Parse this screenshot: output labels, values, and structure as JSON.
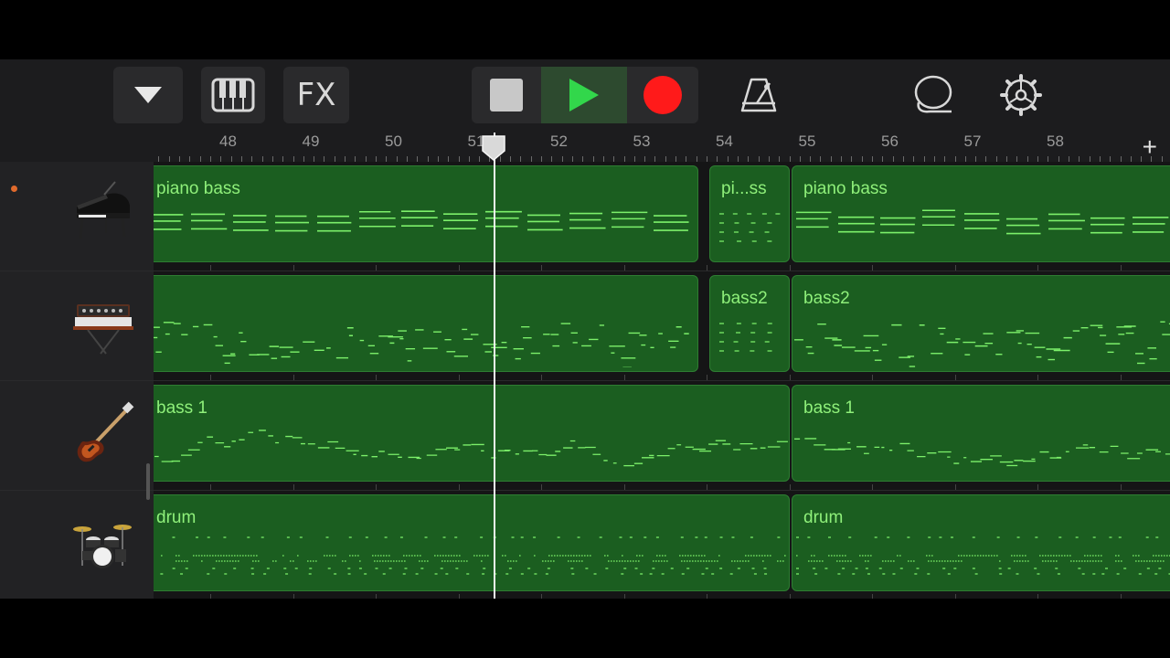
{
  "toolbar": {
    "fx_label": "FX",
    "buttons": [
      {
        "name": "tracks-view-dropdown",
        "icon": "triangle-down-icon"
      },
      {
        "name": "keyboard-button",
        "icon": "piano-keys-icon"
      },
      {
        "name": "fx-button",
        "icon": "fx-icon"
      },
      {
        "name": "stop-button",
        "icon": "stop-icon"
      },
      {
        "name": "play-button",
        "icon": "play-icon"
      },
      {
        "name": "record-button",
        "icon": "record-icon"
      },
      {
        "name": "metronome-button",
        "icon": "metronome-icon"
      },
      {
        "name": "loop-browser-button",
        "icon": "lasso-icon"
      },
      {
        "name": "settings-button",
        "icon": "gear-icon"
      }
    ]
  },
  "ruler": {
    "bars": [
      "48",
      "49",
      "50",
      "51",
      "52",
      "53",
      "54",
      "55",
      "56",
      "57",
      "58"
    ],
    "add_label": "+"
  },
  "tracks": [
    {
      "instrument": "grand-piano-icon",
      "armed": true,
      "regions": [
        {
          "label": "piano bass",
          "style": "dense"
        },
        {
          "label": "pi...ss",
          "style": "sparse"
        },
        {
          "label": "piano bass",
          "style": "dense"
        }
      ]
    },
    {
      "instrument": "synth-keyboard-icon",
      "armed": false,
      "regions": [
        {
          "label": "",
          "style": "scatter"
        },
        {
          "label": "bass2",
          "style": "sparse"
        },
        {
          "label": "bass2",
          "style": "scatter"
        }
      ]
    },
    {
      "instrument": "bass-guitar-icon",
      "armed": false,
      "regions": [
        {
          "label": "bass 1",
          "style": "line"
        },
        {
          "label": "bass 1",
          "style": "line"
        }
      ]
    },
    {
      "instrument": "drum-kit-icon",
      "armed": false,
      "regions": [
        {
          "label": "drum",
          "style": "drums"
        },
        {
          "label": "drum",
          "style": "drums"
        }
      ]
    }
  ],
  "colors": {
    "region_fill": "#1b5e20",
    "note": "#7cf06a",
    "play_active": "#2ecc40",
    "record": "#ff1f1f"
  }
}
